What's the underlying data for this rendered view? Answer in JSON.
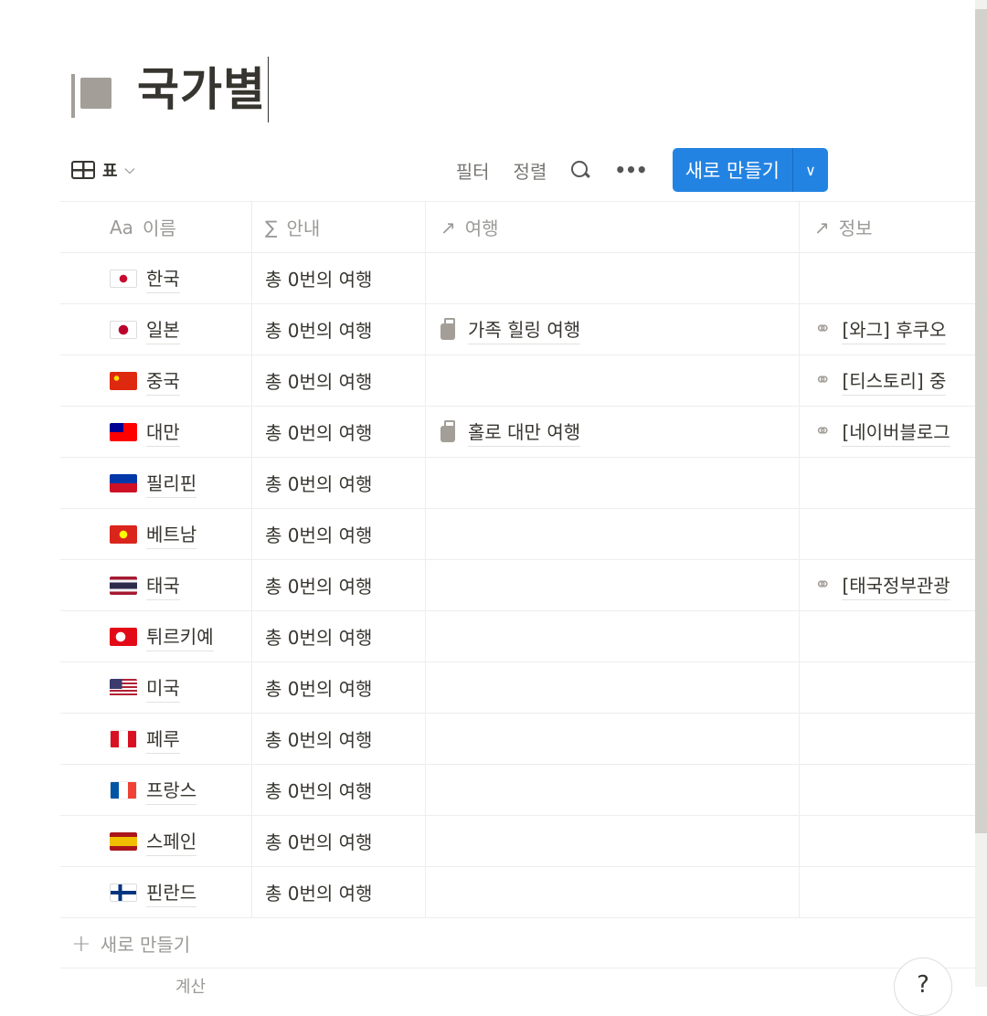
{
  "page": {
    "title": "국가별"
  },
  "toolbar": {
    "view_label": "표",
    "filter": "필터",
    "sort": "정렬",
    "more": "•••",
    "new_label": "새로 만들기",
    "new_dropdown": "⌄"
  },
  "columns": [
    {
      "icon": "Aa",
      "label": "이름"
    },
    {
      "icon": "∑",
      "label": "안내"
    },
    {
      "icon": "↗",
      "label": "여행"
    },
    {
      "icon": "↗",
      "label": "정보"
    }
  ],
  "rows": [
    {
      "flag": "kr",
      "name": "한국",
      "guide": "총 0번의 여행",
      "trip": "",
      "info": ""
    },
    {
      "flag": "jp",
      "name": "일본",
      "guide": "총 0번의 여행",
      "trip": "가족 힐링 여행",
      "info": "[와그] 후쿠오"
    },
    {
      "flag": "cn",
      "name": "중국",
      "guide": "총 0번의 여행",
      "trip": "",
      "info": "[티스토리] 중"
    },
    {
      "flag": "tw",
      "name": "대만",
      "guide": "총 0번의 여행",
      "trip": "홀로 대만 여행",
      "info": "[네이버블로그"
    },
    {
      "flag": "ph",
      "name": "필리핀",
      "guide": "총 0번의 여행",
      "trip": "",
      "info": ""
    },
    {
      "flag": "vn",
      "name": "베트남",
      "guide": "총 0번의 여행",
      "trip": "",
      "info": ""
    },
    {
      "flag": "th",
      "name": "태국",
      "guide": "총 0번의 여행",
      "trip": "",
      "info": "[태국정부관광"
    },
    {
      "flag": "tr",
      "name": "튀르키예",
      "guide": "총 0번의 여행",
      "trip": "",
      "info": ""
    },
    {
      "flag": "us",
      "name": "미국",
      "guide": "총 0번의 여행",
      "trip": "",
      "info": ""
    },
    {
      "flag": "pe",
      "name": "페루",
      "guide": "총 0번의 여행",
      "trip": "",
      "info": ""
    },
    {
      "flag": "fr",
      "name": "프랑스",
      "guide": "총 0번의 여행",
      "trip": "",
      "info": ""
    },
    {
      "flag": "es",
      "name": "스페인",
      "guide": "총 0번의 여행",
      "trip": "",
      "info": ""
    },
    {
      "flag": "fi",
      "name": "핀란드",
      "guide": "총 0번의 여행",
      "trip": "",
      "info": ""
    }
  ],
  "footer": {
    "add_label": "새로 만들기",
    "calc_label": "계산",
    "help": "?"
  }
}
